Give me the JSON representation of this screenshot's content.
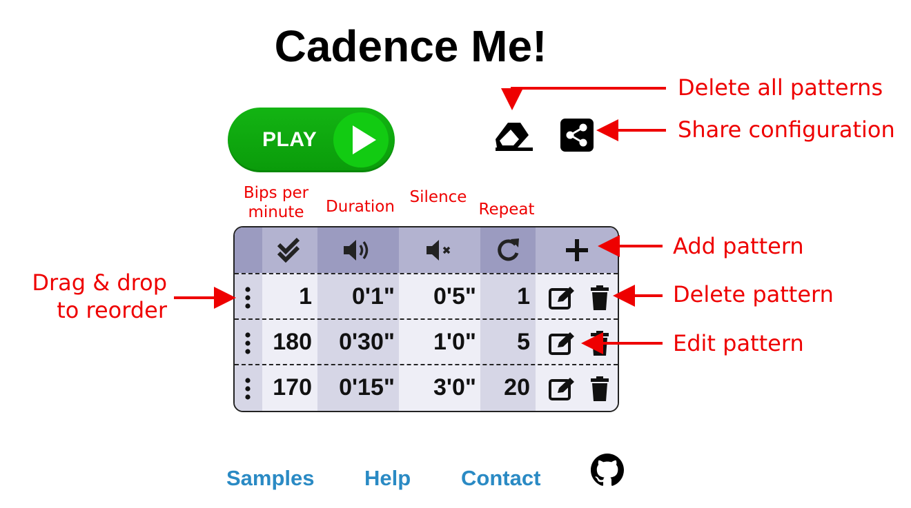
{
  "app": {
    "title": "Cadence Me!"
  },
  "controls": {
    "play_label": "PLAY",
    "icons": [
      "play-icon",
      "eraser-icon",
      "share-icon"
    ]
  },
  "table": {
    "column_labels": {
      "bpm": "Bips per minute",
      "duration": "Duration",
      "silence": "Silence",
      "repeat": "Repeat"
    },
    "header_icons": [
      "double-check-icon",
      "volume-icon",
      "mute-icon",
      "redo-icon",
      "plus-icon"
    ],
    "rows": [
      {
        "bpm": "1",
        "duration": "0'1\"",
        "silence": "0'5\"",
        "repeat": "1"
      },
      {
        "bpm": "180",
        "duration": "0'30\"",
        "silence": "1'0\"",
        "repeat": "5"
      },
      {
        "bpm": "170",
        "duration": "0'15\"",
        "silence": "3'0\"",
        "repeat": "20"
      }
    ]
  },
  "annotations": {
    "delete_all": "Delete all patterns",
    "share": "Share configuration",
    "add": "Add pattern",
    "delete": "Delete pattern",
    "edit": "Edit pattern",
    "drag": "Drag & drop to reorder",
    "color": "#ee0000"
  },
  "footer": {
    "links": [
      "Samples",
      "Help",
      "Contact"
    ],
    "icons": [
      "github-icon"
    ],
    "link_color": "#2a8ac4"
  }
}
